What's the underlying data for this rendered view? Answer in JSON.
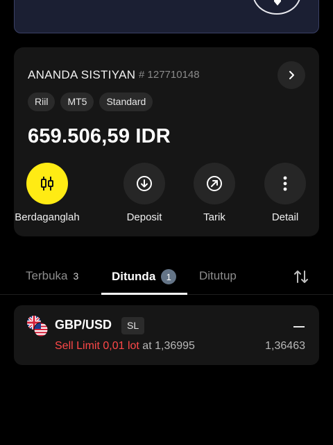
{
  "account": {
    "name": "ANANDA SISTIYAN",
    "id": "# 127710148",
    "tags": [
      "Riil",
      "MT5",
      "Standard"
    ],
    "balance": "659.506,59 IDR"
  },
  "actions": [
    {
      "label": "Berdaganglah",
      "icon": "candlestick-icon"
    },
    {
      "label": "Deposit",
      "icon": "download-arrow-icon"
    },
    {
      "label": "Tarik",
      "icon": "upload-arrow-icon"
    },
    {
      "label": "Detail",
      "icon": "more-vertical-icon"
    }
  ],
  "tabs": [
    {
      "label": "Terbuka",
      "count": "3"
    },
    {
      "label": "Ditunda",
      "count": "1",
      "active": true
    },
    {
      "label": "Ditutup"
    }
  ],
  "order": {
    "symbol": "GBP/USD",
    "badge": "SL",
    "type": "Sell Limit",
    "lot": "0,01 lot",
    "at_label": "at",
    "open_price": "1,36995",
    "current_price": "1,36463"
  },
  "colors": {
    "accent": "#ffeb14",
    "sell": "#ff4848",
    "badge": "#647487"
  }
}
